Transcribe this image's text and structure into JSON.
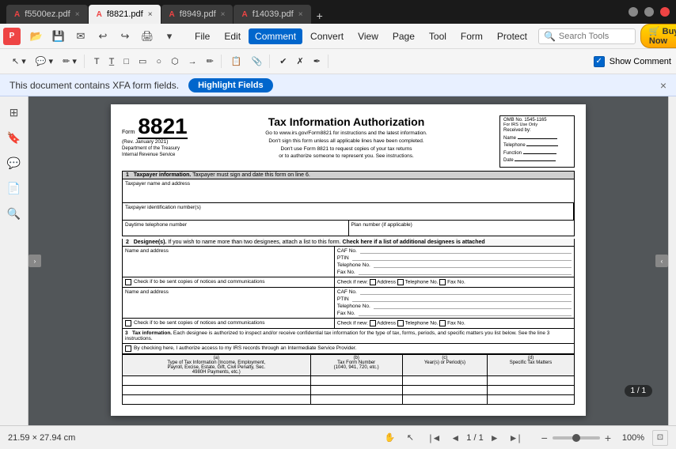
{
  "tabs": [
    {
      "id": "t1",
      "label": "f5500ez.pdf",
      "active": false,
      "closable": true
    },
    {
      "id": "t2",
      "label": "f8821.pdf",
      "active": true,
      "closable": true
    },
    {
      "id": "t3",
      "label": "f8949.pdf",
      "active": false,
      "closable": true
    },
    {
      "id": "t4",
      "label": "f14039.pdf",
      "active": false,
      "closable": true
    }
  ],
  "menubar": {
    "items": [
      "File",
      "Edit",
      "Comment",
      "Convert",
      "View",
      "Page",
      "Tool",
      "Form",
      "Protect"
    ],
    "active": "Comment"
  },
  "toolbar": {
    "groups": [
      [
        "✏",
        "💬",
        "✏️",
        "🔷"
      ],
      [
        "T",
        "T⃞",
        "□",
        "◻",
        "〇",
        "◇",
        "→",
        "✏"
      ],
      [
        "📋",
        "⊞"
      ],
      [
        "✔",
        "✗",
        "✏"
      ]
    ]
  },
  "show_comment": {
    "label": "Show Comment",
    "checked": true
  },
  "xfa_banner": {
    "message": "This document contains XFA form fields.",
    "button_label": "Highlight Fields",
    "close": "×"
  },
  "pdf": {
    "form_label": "Form",
    "form_number": "8821",
    "form_rev": "(Rev. January 2021)",
    "dept": "Department of the Treasury",
    "irs": "Internal Revenue Service",
    "title": "Tax Information Authorization",
    "subtitle_lines": [
      "Go to www.irs.gov/Form8821 for instructions and the latest information.",
      "Don't sign this form unless all applicable lines have been completed.",
      "Don't use Form 8821 to request copies of your tax returns",
      "or to authorize someone to represent you. See instructions."
    ],
    "omb_label": "OMB No. 1545-1165",
    "irs_use": "For IRS Use Only",
    "irs_fields": [
      "Received by:",
      "Name",
      "Telephone",
      "Function",
      "Date"
    ],
    "section1": {
      "number": "1",
      "title": "Taxpayer information.",
      "desc": "Taxpayer must sign and date this form on line 6.",
      "fields": [
        {
          "label": "Taxpayer name and address",
          "colspan": true
        },
        {
          "label": "Taxpayer identification number(s)"
        },
        {
          "label": "Daytime telephone number"
        },
        {
          "label": "Plan number (if applicable)"
        }
      ]
    },
    "section2": {
      "number": "2",
      "title": "Designee(s).",
      "desc": "If you wish to name more than two designees, attach a list to this form.",
      "check_label": "Check here if a list of additional designees is attached",
      "designee_fields": [
        "CAF No.",
        "PTIN",
        "Telephone No.",
        "Fax No."
      ],
      "check_if_new": "Check if new:",
      "check_new_fields": [
        "Address",
        "Telephone No.",
        "Fax No."
      ],
      "copies_label": "Check if to be sent copies of notices and communications",
      "name_address": "Name and address"
    },
    "section3": {
      "number": "3",
      "tax_info_label": "Tax information.",
      "tax_info_desc": "Each designee is authorized to inspect and/or receive confidential tax information for the type of tax, forms, periods, and specific matters you list below. See the line 3 instructions.",
      "isp_label": "By checking here, I authorize access to my IRS records through an Intermediate Service Provider.",
      "columns": [
        {
          "letter": "(a)",
          "label": "Type of Tax Information (Income, Employment,\nPayroll, Excise, Estate, Gift, Civil Penalty, Sec.\n4980H Payments, etc.)"
        },
        {
          "letter": "(b)",
          "label": "Tax Form Number\n(1040, 941, 720, etc.)"
        },
        {
          "letter": "(c)",
          "label": "Year(s) or Period(s)"
        },
        {
          "letter": "(d)",
          "label": "Specific Tax Matters"
        }
      ],
      "rows": [
        "",
        "",
        "",
        ""
      ]
    }
  },
  "status": {
    "dimensions": "21.59 × 27.94 cm",
    "page_current": "1",
    "page_total": "1",
    "zoom": "100%"
  }
}
